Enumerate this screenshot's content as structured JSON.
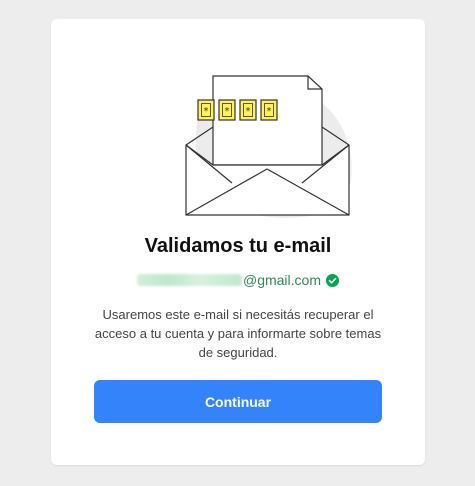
{
  "verification": {
    "title": "Validamos tu e-mail",
    "email_domain": "@gmail.com",
    "email_verified_icon": "check-circle-icon",
    "description": "Usaremos este e-mail si necesitás recuperar el acceso a tu cuenta y para informarte sobre temas de seguridad.",
    "continue_label": "Continuar"
  },
  "colors": {
    "accent": "#3483fa",
    "verified_green": "#00a650",
    "page_background": "#ededed",
    "card_background": "#ffffff",
    "illustration_yellow": "#fff159"
  },
  "illustration": {
    "icon": "envelope-with-password-letter-icon",
    "password_glyph": "*"
  }
}
